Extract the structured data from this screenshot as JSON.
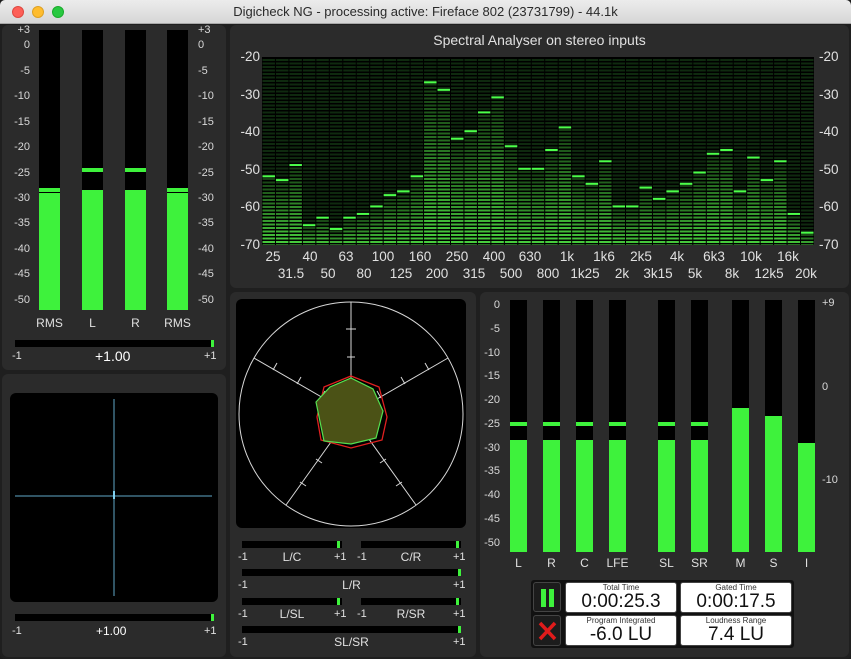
{
  "window": {
    "title": "Digicheck NG - processing active: Fireface 802 (23731799) - 44.1k"
  },
  "level_meter": {
    "scale_left": [
      "+3",
      "0",
      "-5",
      "-10",
      "-15",
      "-20",
      "-25",
      "-30",
      "-35",
      "-40",
      "-45",
      "-50"
    ],
    "scale_right": [
      "+3",
      "0",
      "-5",
      "-10",
      "-15",
      "-20",
      "-25",
      "-30",
      "-35",
      "-40",
      "-45",
      "-50"
    ],
    "bars": [
      {
        "label": "RMS",
        "level_db": -29,
        "peak_db": -28.5
      },
      {
        "label": "L",
        "level_db": -28.5,
        "peak_db": -24.5
      },
      {
        "label": "R",
        "level_db": -28.5,
        "peak_db": -24.5
      },
      {
        "label": "RMS",
        "level_db": -29,
        "peak_db": -28.5
      }
    ],
    "correlation": {
      "min": "-1",
      "max": "+1",
      "value": "+1.00",
      "position": 1.0
    }
  },
  "goniometer": {
    "correlation": {
      "min": "-1",
      "max": "+1",
      "value": "+1.00",
      "position": 1.0
    }
  },
  "spectrum": {
    "title": "Spectral Analyser on stereo inputs",
    "y_ticks": [
      "-20",
      "-30",
      "-40",
      "-50",
      "-60",
      "-70"
    ],
    "bands_top": [
      "25",
      "40",
      "63",
      "100",
      "160",
      "250",
      "400",
      "630",
      "1k",
      "1k6",
      "2k5",
      "4k",
      "6k3",
      "10k",
      "16k"
    ],
    "bands_bottom": [
      "31.5",
      "50",
      "80",
      "125",
      "200",
      "315",
      "500",
      "800",
      "1k25",
      "2k",
      "3k15",
      "5k",
      "8k",
      "12k5",
      "20k"
    ],
    "band_levels_db": [
      -52,
      -53,
      -49,
      -65,
      -63,
      -66,
      -63,
      -62,
      -60,
      -57,
      -56,
      -52,
      -27,
      -29,
      -42,
      -40,
      -35,
      -31,
      -44,
      -50,
      -50,
      -45,
      -39,
      -52,
      -54,
      -48,
      -60,
      -60,
      -55,
      -58,
      -56,
      -54,
      -51,
      -46,
      -45,
      -56,
      -47,
      -53,
      -48,
      -62,
      -67
    ]
  },
  "surround_scope": {
    "pairs": [
      {
        "label": "L/C",
        "min": "-1",
        "max": "+1",
        "position": 0.98
      },
      {
        "label": "C/R",
        "min": "-1",
        "max": "+1",
        "position": 0.98
      },
      {
        "label": "L/R",
        "min": "-1",
        "max": "+1",
        "position": 1.0
      },
      {
        "label": "L/SL",
        "min": "-1",
        "max": "+1",
        "position": 0.98
      },
      {
        "label": "R/SR",
        "min": "-1",
        "max": "+1",
        "position": 0.98
      },
      {
        "label": "SL/SR",
        "min": "-1",
        "max": "+1",
        "position": 1.0
      }
    ]
  },
  "surround_meter": {
    "scale_left": [
      "0",
      "-5",
      "-10",
      "-15",
      "-20",
      "-25",
      "-30",
      "-35",
      "-40",
      "-45",
      "-50"
    ],
    "scale_right": [
      "+9",
      "0",
      "-10"
    ],
    "bars": [
      {
        "label": "L",
        "level_db": -28.5,
        "peak_db": -25
      },
      {
        "label": "R",
        "level_db": -28.5,
        "peak_db": -25
      },
      {
        "label": "C",
        "level_db": -28.5,
        "peak_db": -25
      },
      {
        "label": "LFE",
        "level_db": -28.5,
        "peak_db": -25
      },
      {
        "label": "SL",
        "level_db": -28.5,
        "peak_db": -25
      },
      {
        "label": "SR",
        "level_db": -28.5,
        "peak_db": -25
      },
      {
        "label": "M",
        "level_lu": -2.3
      },
      {
        "label": "S",
        "level_lu": -3.1
      },
      {
        "label": "I",
        "level_lu": -6.0
      }
    ]
  },
  "loudness": {
    "total_time_label": "Total Time",
    "total_time": "0:00:25.3",
    "gated_time_label": "Gated Time",
    "gated_time": "0:00:17.5",
    "program_label": "Program Integrated",
    "program": "-6.0 LU",
    "range_label": "Loudness Range",
    "range": "7.4 LU"
  },
  "colors": {
    "meter": "#3ef23c",
    "grid_bg": "#000000",
    "panel": "#2b2b2b"
  }
}
